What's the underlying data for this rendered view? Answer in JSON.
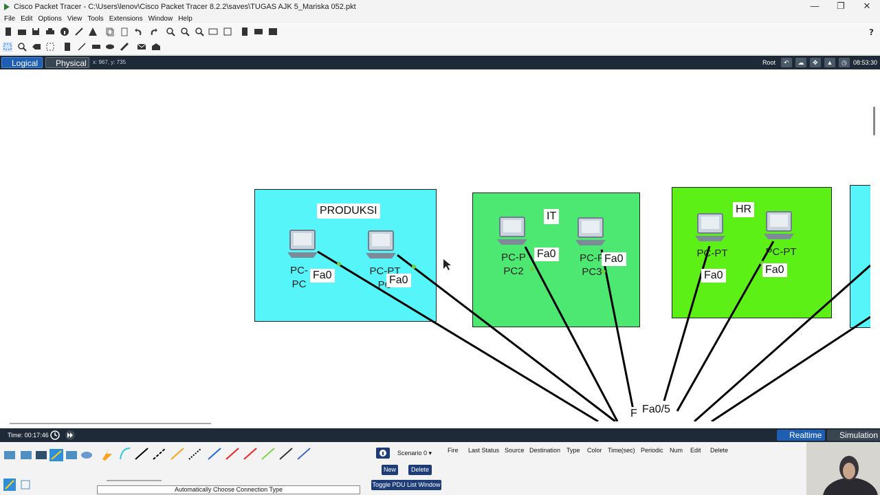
{
  "window": {
    "title": "Cisco Packet Tracer - C:\\Users\\lenov\\Cisco Packet Tracer 8.2.2\\saves\\TUGAS AJK 5_Mariska 052.pkt",
    "controls": [
      "—",
      "❐",
      "✕"
    ]
  },
  "menu": [
    "File",
    "Edit",
    "Options",
    "View",
    "Tools",
    "Extensions",
    "Window",
    "Help"
  ],
  "nav": {
    "logical": "Logical",
    "physical": "Physical",
    "coords": "x: 967, y: 735",
    "root": "Root",
    "clock": "08:53:30"
  },
  "groups": [
    {
      "title": "PRODUKSI",
      "color": "#55f5fa"
    },
    {
      "title": "IT",
      "color": "#4de871"
    },
    {
      "title": "HR",
      "color": "#5cf016"
    },
    {
      "title": "",
      "color": "#55f5fa"
    }
  ],
  "pcs": {
    "produksi_a": "PC-\nPC",
    "produksi_b": "PC-PT\nPC",
    "it_a": "PC-P\nPC2",
    "it_b": "PC-P\nPC3",
    "hr_a": "PC-PT",
    "hr_b": "PC-PT"
  },
  "ports": {
    "p1": "Fa0",
    "p2": "Fa0",
    "p3": "Fa0",
    "p4": "Fa0",
    "p5": "Fa0",
    "p6": "Fa0",
    "switch_port": "Fa0/5",
    "switch_prefix": "F"
  },
  "status": {
    "time": "Time: 00:17:46",
    "realtime": "Realtime",
    "simulation": "Simulation"
  },
  "bottom": {
    "conn_type": "Automatically Choose Connection Type",
    "scenario": "Scenario 0",
    "new": "New",
    "delete": "Delete",
    "toggle": "Toggle PDU List Window",
    "pdu_columns": [
      "Fire",
      "Last Status",
      "Source",
      "Destination",
      "Type",
      "Color",
      "Time(sec)",
      "Periodic",
      "Num",
      "Edit",
      "Delete"
    ]
  }
}
